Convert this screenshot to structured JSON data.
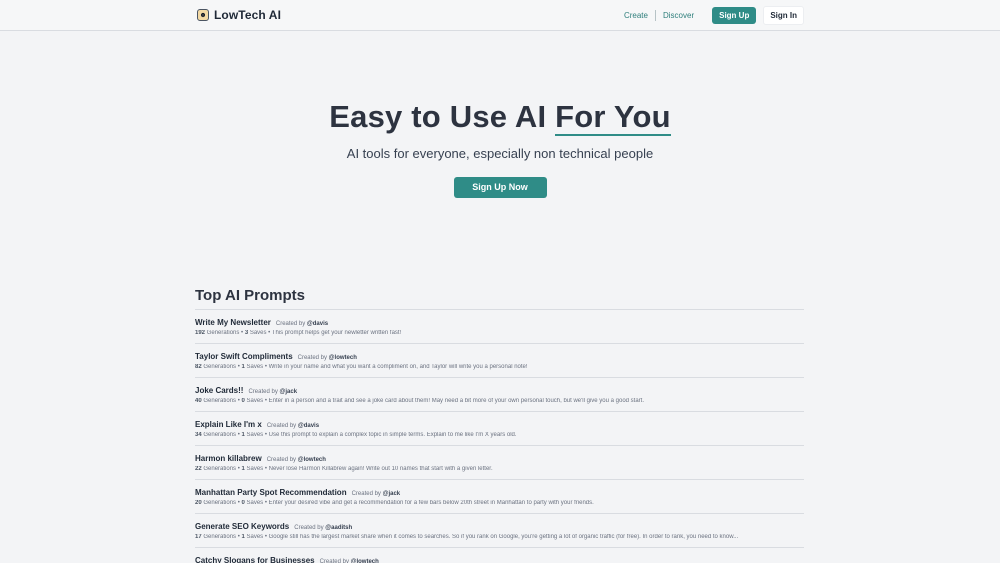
{
  "nav": {
    "brand_name": "LowTech AI",
    "brand_icon": "robot-emoji",
    "create": "Create",
    "discover": "Discover",
    "signup": "Sign Up",
    "signin": "Sign In"
  },
  "hero": {
    "title_main": "Easy to Use AI ",
    "title_highlight": "For You",
    "subtitle": "AI tools for everyone, especially non technical people",
    "cta": "Sign Up Now"
  },
  "prompts": {
    "section_title": "Top AI Prompts",
    "created_by_label": "Created by",
    "generations_label": "Generations",
    "saves_label": "Saves",
    "items": [
      {
        "name": "Write My Newsletter",
        "author": "@davis",
        "generations": "192",
        "saves": "3",
        "description": "This prompt helps get your newletter written fast!"
      },
      {
        "name": "Taylor Swift Compliments",
        "author": "@lowtech",
        "generations": "82",
        "saves": "1",
        "description": "Write in your name and what you want a compliment on, and Taylor will write you a personal note!"
      },
      {
        "name": "Joke Cards!!",
        "author": "@jack",
        "generations": "40",
        "saves": "0",
        "description": "Enter in a person and a trait and see a joke card about them! May need a bit more of your own personal touch, but we'll give you a good start."
      },
      {
        "name": "Explain Like I'm x",
        "author": "@davis",
        "generations": "34",
        "saves": "1",
        "description": "Use this prompt to explain a complex topic in simple terms. Explain to me like I'm X years old."
      },
      {
        "name": "Harmon killabrew",
        "author": "@lowtech",
        "generations": "22",
        "saves": "1",
        "description": "Never lose Harmon Killabrew again! Write out 10 names that start with a given letter."
      },
      {
        "name": "Manhattan Party Spot Recommendation",
        "author": "@jack",
        "generations": "20",
        "saves": "0",
        "description": "Enter your desired vibe and get a recommendation for a few bars below 20th street in Manhattan to party with your friends."
      },
      {
        "name": "Generate SEO Keywords",
        "author": "@aaditsh",
        "generations": "17",
        "saves": "1",
        "description": "Google still has the largest market share when it comes to searches. So if you rank on Google, you're getting a lot of organic traffic (for free). In order to rank, you need to know..."
      },
      {
        "name": "Catchy Slogans for Businesses",
        "author": "@lowtech",
        "generations": "",
        "saves": "",
        "description": ""
      }
    ]
  }
}
